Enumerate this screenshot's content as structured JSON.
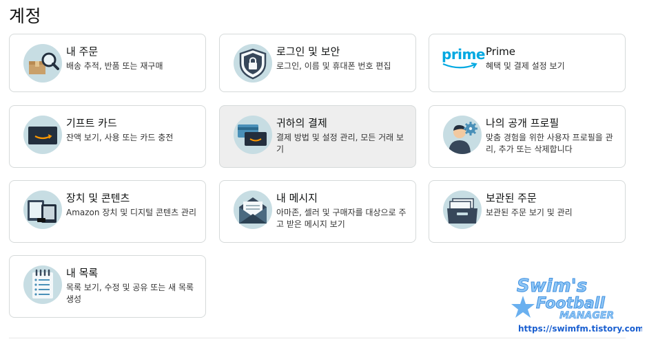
{
  "page": {
    "title": "계정"
  },
  "cards": [
    {
      "title": "내 주문",
      "desc": "배송 추적, 반품 또는 재구매",
      "icon": "order-package-search-icon"
    },
    {
      "title": "로그인 및 보안",
      "desc": "로그인, 이름 및 휴대폰 번호 편집",
      "icon": "security-shield-lock-icon"
    },
    {
      "title": "Prime",
      "desc": "혜택 및 결제 설정 보기",
      "icon": "prime-logo-icon",
      "logo_text": "prime"
    },
    {
      "title": "기프트 카드",
      "desc": "잔액 보기, 사용 또는 카드 충전",
      "icon": "gift-card-icon"
    },
    {
      "title": "귀하의 결제",
      "desc": "결제 방법 및 설정 관리, 모든 거래 보기",
      "icon": "payment-cards-icon"
    },
    {
      "title": "나의 공개 프로필",
      "desc": "맞춤 경험을 위한 사용자 프로필을 관리, 추가 또는 삭제합니다",
      "icon": "profile-gear-icon"
    },
    {
      "title": "장치 및 콘텐츠",
      "desc": "Amazon 장치 및 디지털 콘텐츠 관리",
      "icon": "devices-icon"
    },
    {
      "title": "내 메시지",
      "desc": "아마존, 셀러 및 구매자를 대상으로 주고 받은 메시지 보기",
      "icon": "envelope-message-icon"
    },
    {
      "title": "보관된 주문",
      "desc": "보관된 주문 보기 및 관리",
      "icon": "archive-box-icon"
    },
    {
      "title": "내 목록",
      "desc": "목록 보기, 수정 및 공유 또는 새 목록 생성",
      "icon": "list-notepad-icon"
    }
  ],
  "watermark": {
    "line1": "Swim's",
    "line2": "Football",
    "line3": "MANAGER",
    "url": "https://swimfm.tistory.com/"
  }
}
